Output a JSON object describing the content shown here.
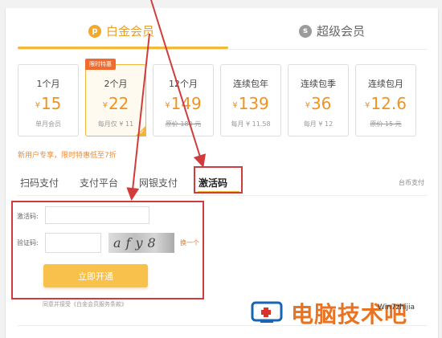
{
  "top_tabs": [
    {
      "label": "白金会员",
      "icon": "p"
    },
    {
      "label": "超级会员",
      "icon": "s"
    }
  ],
  "plans": [
    {
      "name": "1个月",
      "currency": "¥",
      "price": "15",
      "sub": "单月会员",
      "strike": false
    },
    {
      "name": "2个月",
      "currency": "¥",
      "price": "22",
      "sub": "每月仅 ¥ 11",
      "strike": false,
      "badge": "限时特惠",
      "selected": true
    },
    {
      "name": "12个月",
      "currency": "¥",
      "price": "149",
      "sub": "原价 180 元",
      "strike": true
    },
    {
      "name": "连续包年",
      "currency": "¥",
      "price": "139",
      "sub": "每月 ¥ 11.58",
      "strike": false
    },
    {
      "name": "连续包季",
      "currency": "¥",
      "price": "36",
      "sub": "每月 ¥ 12",
      "strike": false
    },
    {
      "name": "连续包月",
      "currency": "¥",
      "price": "12.6",
      "sub": "原价 15 元",
      "strike": true
    }
  ],
  "promo_text": "新用户专享，限时特惠低至7折",
  "pay_tabs": [
    "扫码支付",
    "支付平台",
    "网银支付",
    "激活码"
  ],
  "coin_pay": "台币支付",
  "form": {
    "code_label": "激活码:",
    "captcha_label": "验证码:",
    "captcha_text": "afy8",
    "refresh_label": "换一个",
    "submit_label": "立即开通",
    "agree_text": "同意并接受《白金会员服务条款》"
  },
  "watermark": {
    "text": "电脑技术吧",
    "small": "Win7zhijia"
  },
  "colors": {
    "accent": "#f3b93a",
    "price": "#f09322",
    "highlight_box": "#d03c3c",
    "badge": "#f26b2c"
  }
}
